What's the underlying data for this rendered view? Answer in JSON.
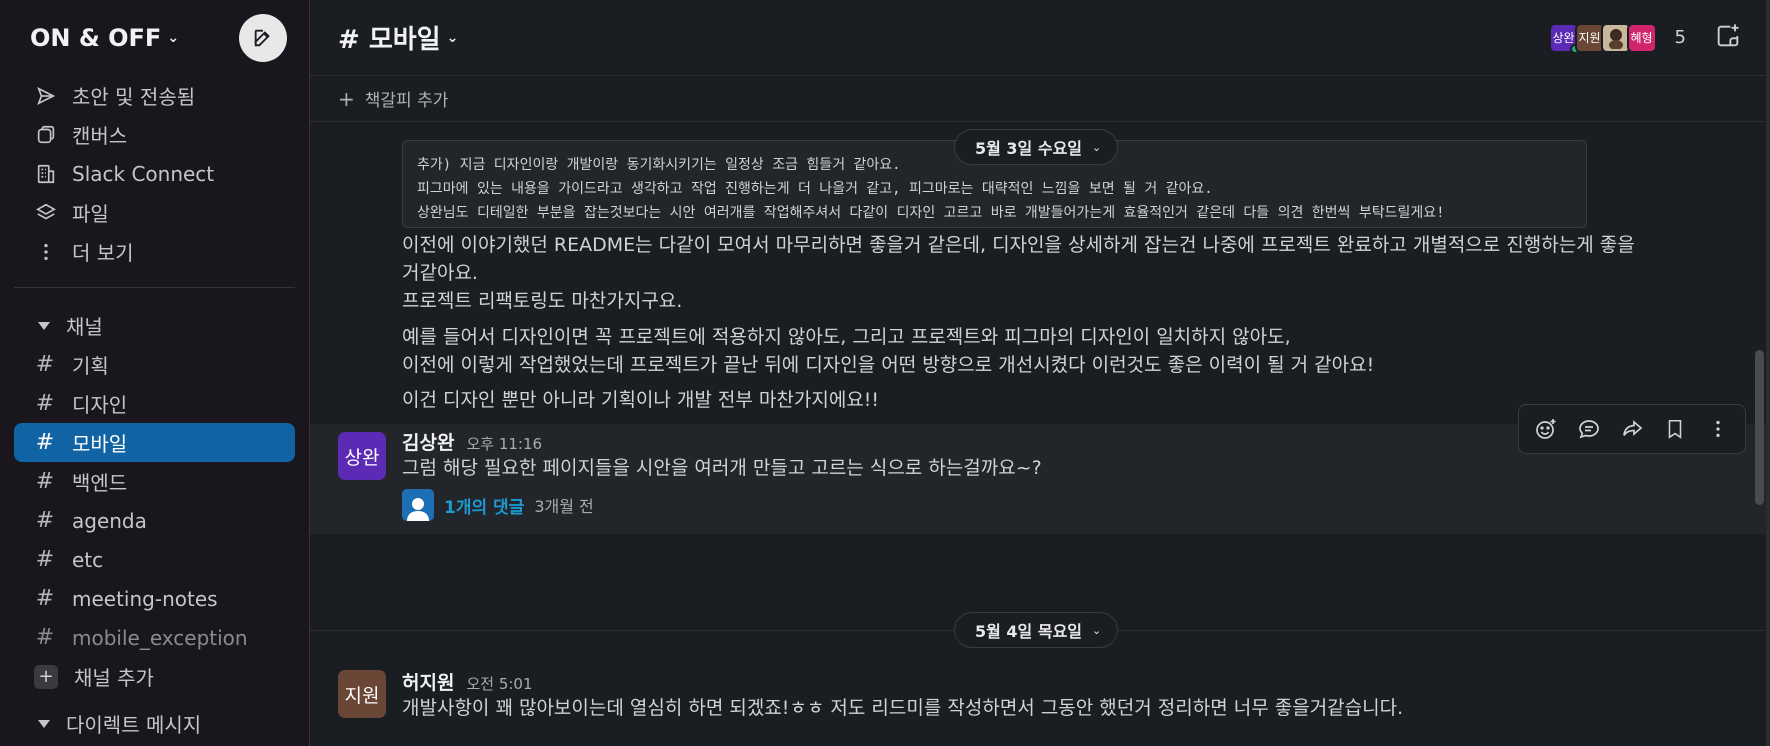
{
  "workspace": {
    "name": "ON & OFF"
  },
  "sidebar": {
    "nav": [
      {
        "label": "초안 및 전송됨",
        "icon": "send-icon"
      },
      {
        "label": "캔버스",
        "icon": "canvas-icon"
      },
      {
        "label": "Slack Connect",
        "icon": "building-icon"
      },
      {
        "label": "파일",
        "icon": "layers-icon"
      },
      {
        "label": "더 보기",
        "icon": "more-vertical-icon"
      }
    ],
    "channels_header": "채널",
    "channels": [
      {
        "name": "기획"
      },
      {
        "name": "디자인"
      },
      {
        "name": "모바일"
      },
      {
        "name": "백엔드"
      },
      {
        "name": "agenda"
      },
      {
        "name": "etc"
      },
      {
        "name": "meeting-notes"
      },
      {
        "name": "mobile_exception"
      }
    ],
    "add_channel": "채널 추가",
    "dm_header": "다이렉트 메시지"
  },
  "channel": {
    "title": "# 모바일",
    "members": [
      {
        "label": "상완",
        "color": "#5b2bb5"
      },
      {
        "label": "지원",
        "color": "#6a4636"
      },
      {
        "label": "",
        "color": "#c9b79c"
      },
      {
        "label": "혜형",
        "color": "#d0256a"
      }
    ],
    "member_count": "5",
    "bookmark_label": "책갈피 추가"
  },
  "messages": {
    "date_1": "5월 3일 수요일",
    "date_2": "5월 4일 목요일",
    "code_lines": [
      "추가) 지금 디자인이랑 개발이랑 동기화시키기는 일정상 조금 힘들거 같아요.",
      "피그마에 있는 내용을 가이드라고 생각하고 작업 진행하는게 더 나을거 같고, 피그마로는 대략적인 느낌을 보면 될 거 같아요.",
      "상완님도 디테일한 부분을 잡는것보다는 시안 여러개를 작업해주셔서 다같이 디자인 고르고 바로 개발들어가는게 효율적인거 같은데 다들 의견 한번씩 부탁드릴게요!"
    ],
    "para_1_line_1": "이전에 이야기했던 README는 다같이 모여서 마무리하면 좋을거 같은데, 디자인을 상세하게 잡는건 나중에 프로젝트 완료하고 개별적으로 진행하는게 좋을",
    "para_1_line_2": "거같아요.",
    "para_1_line_3": "프로젝트 리팩토링도 마찬가지구요.",
    "para_2_line_1": "예를 들어서 디자인이면 꼭 프로젝트에 적용하지 않아도, 그리고 프로젝트와 피그마의 디자인이 일치하지 않아도,",
    "para_2_line_2": "이전에 이렇게 작업했었는데 프로젝트가 끝난 뒤에 디자인을 어떤 방향으로 개선시켰다 이런것도 좋은 이력이 될 거 같아요!",
    "para_3": "이건 디자인 뿐만 아니라 기획이나 개발 전부 마찬가지에요!!",
    "msg_1": {
      "avatar": "상완",
      "author": "김상완",
      "time": "오후 11:16",
      "text": "그럼 해당 필요한 페이지들을 시안을 여러개 만들고 고르는 식으로 하는걸까요~?",
      "thread_link": "1개의 댓글",
      "thread_time": "3개월 전"
    },
    "msg_2": {
      "avatar": "지원",
      "author": "허지원",
      "time": "오전 5:01",
      "text": "개발사항이 꽤 많아보이는데 열심히 하면 되겠죠!ㅎㅎ 저도 리드미를 작성하면서 그동안 했던거 정리하면 너무 좋을거같습니다."
    }
  },
  "colors": {
    "active_channel": "#1164a3",
    "link": "#1d9bd1",
    "avatar_sangwan": "#5b2bb5",
    "avatar_jiwon": "#6a4636"
  }
}
